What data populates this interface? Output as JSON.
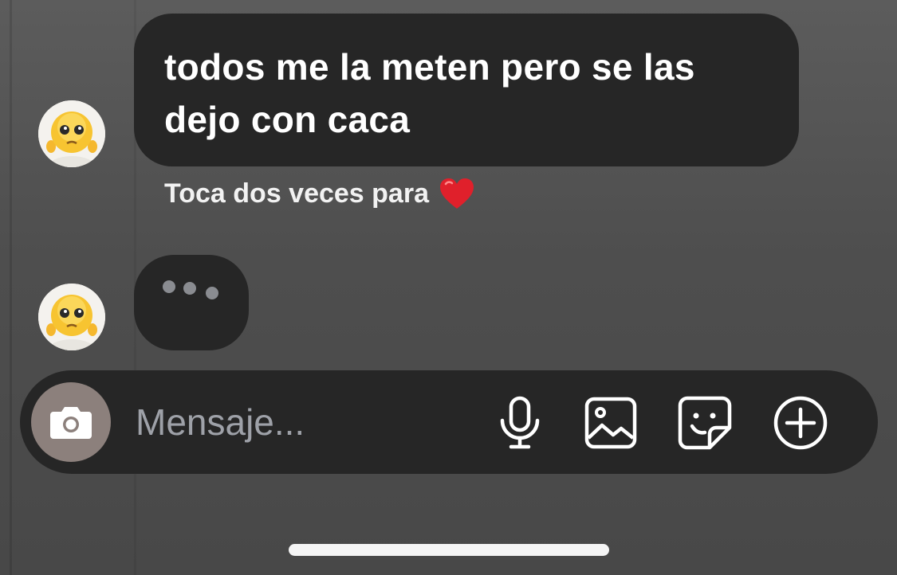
{
  "conversation": {
    "messages": [
      {
        "sender_avatar": "crying-emoji-avatar",
        "text": "todos me la meten pero se las dejo con caca"
      }
    ],
    "hint": {
      "text": "Toca dos veces para",
      "icon": "red-heart-icon"
    },
    "typing_indicator": {
      "avatar": "crying-emoji-avatar",
      "dots": 3
    }
  },
  "composer": {
    "placeholder": "Mensaje...",
    "buttons": [
      {
        "name": "camera",
        "icon": "camera-icon"
      },
      {
        "name": "voice",
        "icon": "microphone-icon"
      },
      {
        "name": "gallery",
        "icon": "image-icon"
      },
      {
        "name": "sticker",
        "icon": "sticker-icon"
      },
      {
        "name": "more",
        "icon": "plus-circle-icon"
      }
    ]
  },
  "colors": {
    "background": "#4e4e4e",
    "bubble": "#262626",
    "camera_button": "#8c807c",
    "placeholder": "#9ea1a8",
    "typing_dot": "#8a8c91",
    "heart": "#e0202b"
  }
}
